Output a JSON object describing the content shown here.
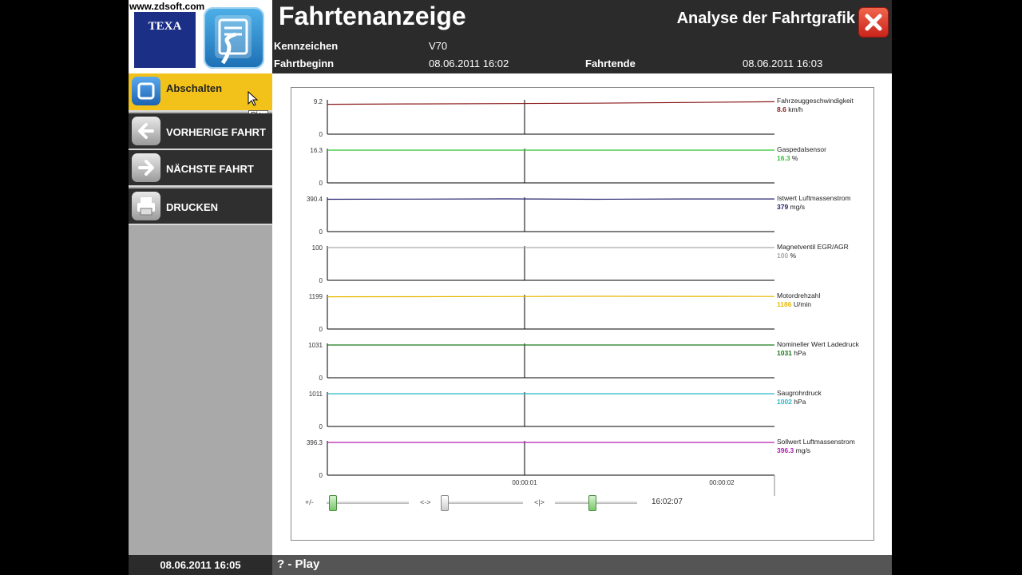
{
  "watermark": "www.zdsoft.com",
  "logo_text": "TEXA",
  "header": {
    "title": "Fahrtenanzeige",
    "subtitle": "Analyse der Fahrtgrafik",
    "kennzeichen_label": "Kennzeichen",
    "kennzeichen_value": "V70",
    "fahrtbeginn_label": "Fahrtbeginn",
    "fahrtbeginn_value": "08.06.2011 16:02",
    "fahrtende_label": "Fahrtende",
    "fahrtende_value": "08.06.2011 16:03"
  },
  "sidebar": {
    "items": [
      {
        "label": "Abschalten",
        "icon": "stop-icon",
        "active": true
      },
      {
        "label": "VORHERIGE FAHRT",
        "icon": "arrow-left-icon",
        "active": false
      },
      {
        "label": "NÄCHSTE FAHRT",
        "icon": "arrow-right-icon",
        "active": false
      },
      {
        "label": "DRUCKEN",
        "icon": "printer-icon",
        "active": false
      }
    ],
    "tooltip": "Play"
  },
  "footer": {
    "date": "08.06.2011  16:05",
    "status": "? - Play"
  },
  "colors": {
    "header_bg": "#2b2b2b",
    "active_yellow": "#f2c21b",
    "close_red": "#d8392a"
  },
  "chart_data": {
    "type": "line",
    "x_ticks": [
      "00:00:01",
      "00:00:02"
    ],
    "cursor_x": "00:00:01",
    "series": [
      {
        "name": "Fahrzeuggeschwindigkeit",
        "ymax": "9.2",
        "ymin": "0",
        "value": "8.6",
        "unit": "km/h",
        "color": "#8b1a1a",
        "values": [
          8.4,
          8.5,
          8.6,
          8.7,
          8.9,
          9.1
        ]
      },
      {
        "name": "Gaspedalsensor",
        "ymax": "16.3",
        "ymin": "0",
        "value": "16.3",
        "unit": "%",
        "color": "#2fc42f",
        "values": [
          16.3,
          16.3,
          16.3,
          16.3,
          16.3,
          16.3
        ]
      },
      {
        "name": "Istwert Luftmassenstrom",
        "ymax": "390.4",
        "ymin": "0",
        "value": "379",
        "unit": "mg/s",
        "color": "#22226e",
        "values": [
          386,
          388,
          390,
          386,
          389,
          389
        ]
      },
      {
        "name": "Magnetventil EGR/AGR",
        "ymax": "100",
        "ymin": "0",
        "value": "100",
        "unit": "%",
        "color": "#aaaaaa",
        "values": [
          100,
          100,
          100,
          100,
          100,
          100
        ]
      },
      {
        "name": "Motordrehzahl",
        "ymax": "1199",
        "ymin": "0",
        "value": "1186",
        "unit": "U/min",
        "color": "#e6b800",
        "values": [
          1180,
          1183,
          1190,
          1199,
          1196,
          1192
        ]
      },
      {
        "name": "Nomineller Wert Ladedruck",
        "ymax": "1031",
        "ymin": "0",
        "value": "1031",
        "unit": "hPa",
        "color": "#1a7a1a",
        "values": [
          1031,
          1031,
          1031,
          1031,
          1031,
          1031
        ]
      },
      {
        "name": "Saugrohrdruck",
        "ymax": "1011",
        "ymin": "0",
        "value": "1002",
        "unit": "hPa",
        "color": "#2ab8c8",
        "values": [
          1011,
          1011,
          1011,
          1011,
          1011,
          1011
        ]
      },
      {
        "name": "Sollwert Luftmassenstrom",
        "ymax": "396.3",
        "ymin": "0",
        "value": "396.3",
        "unit": "mg/s",
        "color": "#b020b0",
        "values": [
          396.3,
          396.3,
          396.3,
          396.3,
          396.3,
          396.3
        ]
      }
    ]
  },
  "controls": {
    "zoom_label": "+/-",
    "range_label": "<->",
    "pos_label": "<|>",
    "time": "16:02:07"
  }
}
